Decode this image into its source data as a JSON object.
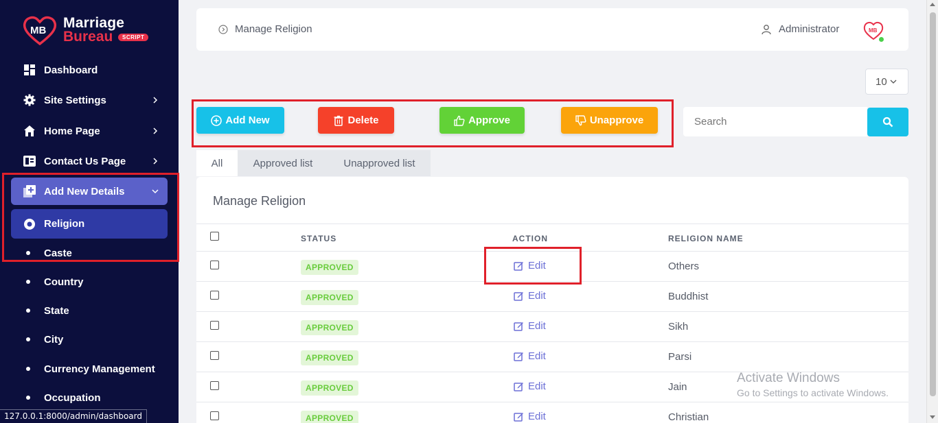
{
  "brand": {
    "line1": "Marriage",
    "line2": "Bureau",
    "tag": "SCRIPT",
    "mark_text": "MB",
    "primary_color": "#e8314a",
    "sidebar_color": "#0c0f3d"
  },
  "sidebar": {
    "items": [
      {
        "label": "Dashboard",
        "icon": "dashboard-icon"
      },
      {
        "label": "Site Settings",
        "icon": "gear-icon"
      },
      {
        "label": "Home Page",
        "icon": "home-icon"
      },
      {
        "label": "Contact Us Page",
        "icon": "contact-page-icon"
      },
      {
        "label": "Add New Details",
        "icon": "add-details-icon",
        "expanded": true
      }
    ],
    "active": {
      "label": "Religion",
      "icon": "radio-dot-icon"
    },
    "subitems": [
      "Caste",
      "Country",
      "State",
      "City",
      "Currency Management",
      "Occupation"
    ]
  },
  "statusbar": {
    "url": "127.0.0.1:8000/admin/dashboard"
  },
  "header": {
    "title": "Manage Religion",
    "user": "Administrator",
    "avatar_text": "MB"
  },
  "toolbar": {
    "per_page": "10",
    "add_label": "Add New",
    "delete_label": "Delete",
    "approve_label": "Approve",
    "unapprove_label": "Unapprove",
    "search_placeholder": "Search"
  },
  "tabs": [
    "All",
    "Approved list",
    "Unapproved list"
  ],
  "table": {
    "title": "Manage Religion",
    "columns": [
      "STATUS",
      "ACTION",
      "RELIGION NAME"
    ],
    "rows": [
      {
        "status": "APPROVED",
        "action": "Edit",
        "name": "Others"
      },
      {
        "status": "APPROVED",
        "action": "Edit",
        "name": "Buddhist"
      },
      {
        "status": "APPROVED",
        "action": "Edit",
        "name": "Sikh"
      },
      {
        "status": "APPROVED",
        "action": "Edit",
        "name": "Parsi"
      },
      {
        "status": "APPROVED",
        "action": "Edit",
        "name": "Jain"
      },
      {
        "status": "APPROVED",
        "action": "Edit",
        "name": "Christian"
      }
    ]
  },
  "watermark": {
    "line1": "Activate Windows",
    "line2": "Go to Settings to activate Windows."
  }
}
